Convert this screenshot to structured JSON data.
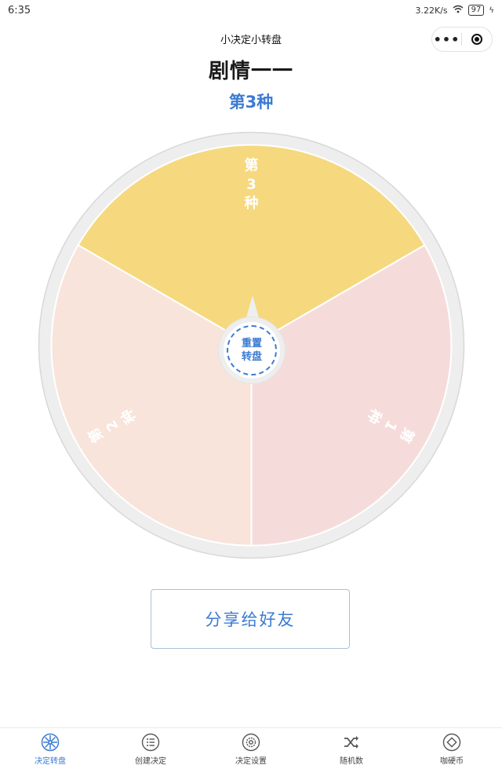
{
  "status_bar": {
    "time": "6:35",
    "net_speed": "3.22K/s",
    "battery": "97"
  },
  "nav": {
    "title": "小决定小转盘"
  },
  "page": {
    "title": "剧情一一",
    "result": "第3种"
  },
  "wheel": {
    "reset_line1": "重置",
    "reset_line2": "转盘",
    "segments": [
      {
        "label": "第1种",
        "color": "#f5dcdb"
      },
      {
        "label": "第2种",
        "color": "#f8e4da"
      },
      {
        "label": "第3种",
        "color": "#f6d87e"
      }
    ],
    "rim_color": "#eeeeee",
    "accent_color": "#3c7bd2"
  },
  "share_button": {
    "label": "分享给好友"
  },
  "tabs": [
    {
      "label": "决定转盘",
      "icon": "wheel-icon",
      "active": true
    },
    {
      "label": "创建决定",
      "icon": "list-icon",
      "active": false
    },
    {
      "label": "决定设置",
      "icon": "gear-icon",
      "active": false
    },
    {
      "label": "随机数",
      "icon": "shuffle-icon",
      "active": false
    },
    {
      "label": "咖硬币",
      "icon": "coin-icon",
      "active": false
    }
  ]
}
